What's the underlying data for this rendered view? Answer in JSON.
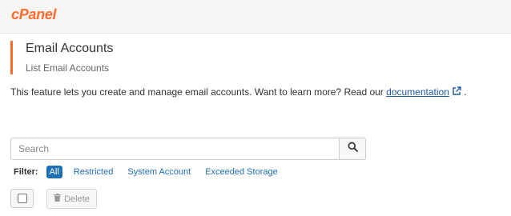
{
  "brand": {
    "logo_text": "cPanel",
    "accent_color": "#ff6c2c"
  },
  "page": {
    "title": "Email Accounts",
    "subtitle": "List Email Accounts"
  },
  "description": {
    "text": "This feature lets you create and manage email accounts. Want to learn more? Read our ",
    "link_text": "documentation",
    "suffix": " .",
    "link_icon": "external-link-icon"
  },
  "search": {
    "placeholder": "Search",
    "value": "",
    "button_icon": "search-icon"
  },
  "filter": {
    "label": "Filter:",
    "options": [
      "All",
      "Restricted",
      "System Account",
      "Exceeded Storage"
    ],
    "selected": "All"
  },
  "toolbar": {
    "delete_label": "Delete",
    "delete_icon": "trash-icon"
  }
}
